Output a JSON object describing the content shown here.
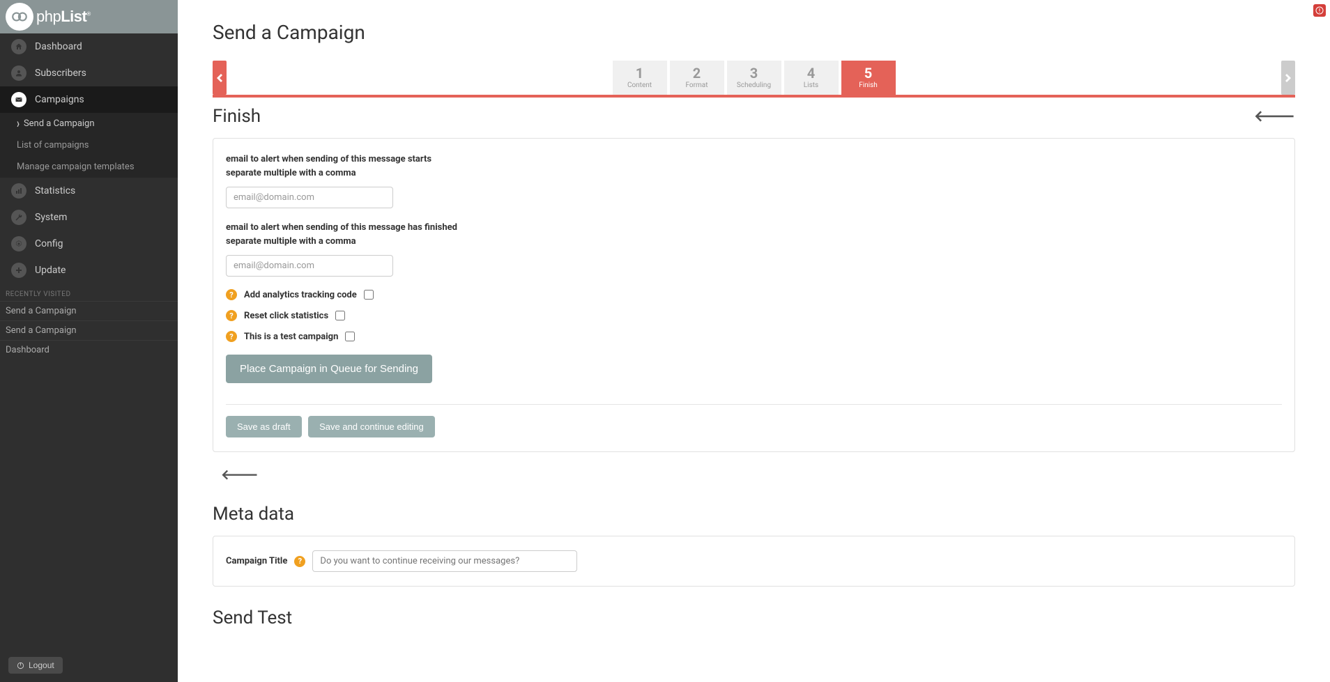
{
  "brand": {
    "logo_text_1": "php",
    "logo_text_2": "List"
  },
  "sidebar": {
    "items": [
      {
        "label": "Dashboard",
        "name": "dashboard"
      },
      {
        "label": "Subscribers",
        "name": "subscribers"
      },
      {
        "label": "Campaigns",
        "name": "campaigns"
      },
      {
        "label": "Statistics",
        "name": "statistics"
      },
      {
        "label": "System",
        "name": "system"
      },
      {
        "label": "Config",
        "name": "config"
      },
      {
        "label": "Update",
        "name": "update"
      }
    ],
    "campaigns_sub": [
      {
        "label": "Send a Campaign",
        "selected": true
      },
      {
        "label": "List of campaigns",
        "selected": false
      },
      {
        "label": "Manage campaign templates",
        "selected": false
      }
    ],
    "recent_header": "RECENTLY VISITED",
    "recent": [
      "Send a Campaign",
      "Send a Campaign",
      "Dashboard"
    ],
    "logout": "Logout"
  },
  "page": {
    "title": "Send a Campaign",
    "steps": [
      {
        "num": "1",
        "label": "Content"
      },
      {
        "num": "2",
        "label": "Format"
      },
      {
        "num": "3",
        "label": "Scheduling"
      },
      {
        "num": "4",
        "label": "Lists"
      },
      {
        "num": "5",
        "label": "Finish"
      }
    ],
    "active_step": 4,
    "section_title": "Finish"
  },
  "finish": {
    "start_label_1": "email to alert when sending of this message starts",
    "start_label_2": "separate multiple with a comma",
    "start_placeholder": "email@domain.com",
    "finish_label_1": "email to alert when sending of this message has finished",
    "finish_label_2": "separate multiple with a comma",
    "finish_placeholder": "email@domain.com",
    "analytics_label": "Add analytics tracking code",
    "reset_label": "Reset click statistics",
    "test_label": "This is a test campaign",
    "queue_button": "Place Campaign in Queue for Sending",
    "save_draft": "Save as draft",
    "save_continue": "Save and continue editing"
  },
  "meta": {
    "heading": "Meta data",
    "title_label": "Campaign Title",
    "title_placeholder": "Do you want to continue receiving our messages?"
  },
  "sendtest": {
    "heading": "Send Test"
  },
  "colors": {
    "accent": "#e46258"
  }
}
